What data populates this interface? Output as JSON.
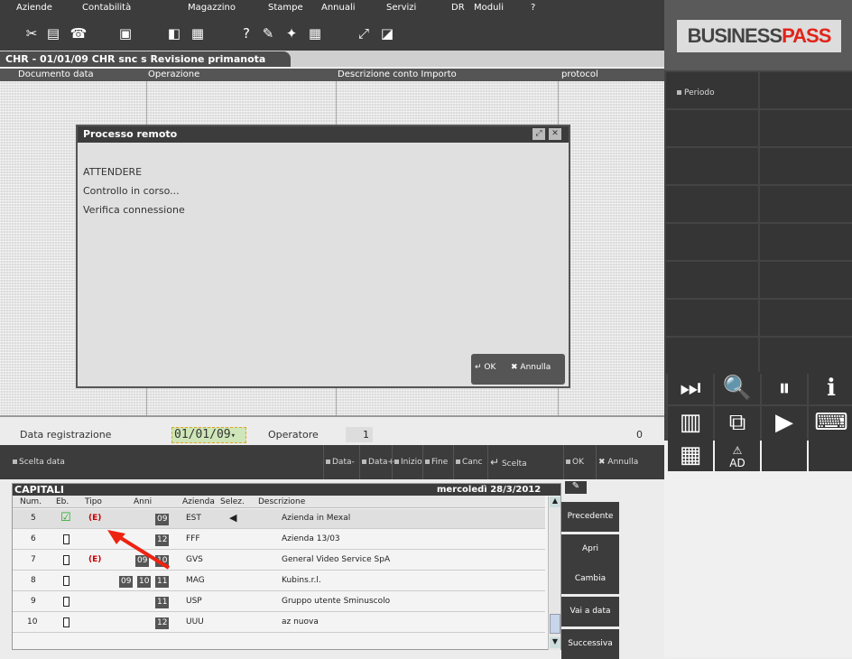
{
  "menu": [
    "Aziende",
    "Contabilità",
    "Magazzino",
    "Stampe",
    "Annuali",
    "Servizi",
    "DR",
    "Moduli",
    "?"
  ],
  "brand": {
    "part1": "BUSINESS",
    "part2": "PASS"
  },
  "tab": {
    "title": "CHR - 01/01/09  CHR snc s  Revisione primanota"
  },
  "columns": {
    "doc": "Documento  data",
    "op": "Operazione",
    "desc": "Descrizione  conto  Importo",
    "prot": "protocol"
  },
  "dialog": {
    "title": "Processo remoto",
    "line1": "ATTENDERE",
    "line2": "Controllo in corso...",
    "line3": "Verifica connessione",
    "ok": "OK",
    "cancel": "Annulla"
  },
  "form": {
    "date_label": "Data registrazione",
    "date_value": "01/01/09",
    "operator_label": "Operatore",
    "operator_value": "1",
    "count": "0"
  },
  "bottom": {
    "scelta_data": "Scelta data",
    "data_minus": "Data-",
    "data_plus": "Data+",
    "inizio": "Inizio",
    "fine": "Fine",
    "canc": "Canc",
    "scelta": "Scelta",
    "ok": "OK",
    "annulla": "Annulla"
  },
  "right_panel": {
    "periodo": "Periodo",
    "ad": "AD"
  },
  "grid": {
    "title": "CAPITALI",
    "date": "mercoledì 28/3/2012",
    "headers": {
      "num": "Num.",
      "eb": "Eb.",
      "tipo": "Tipo",
      "anni": "Anni",
      "azienda": "Azienda",
      "selez": "Selez.",
      "descr": "Descrizione"
    },
    "rows": [
      {
        "num": "5",
        "tipo": "(E)",
        "anni": [
          "09"
        ],
        "azienda": "EST",
        "descr": "Azienda in Mexal"
      },
      {
        "num": "6",
        "tipo": "",
        "anni": [
          "12"
        ],
        "azienda": "FFF",
        "descr": "Azienda 13/03"
      },
      {
        "num": "7",
        "tipo": "(E)",
        "anni": [
          "09",
          "10"
        ],
        "azienda": "GVS",
        "descr": "General Video Service SpA"
      },
      {
        "num": "8",
        "tipo": "",
        "anni": [
          "09",
          "10",
          "11"
        ],
        "azienda": "MAG",
        "descr": "Kubins.r.l."
      },
      {
        "num": "9",
        "tipo": "",
        "anni": [
          "11"
        ],
        "azienda": "USP",
        "descr": "Gruppo utente Sminuscolo"
      },
      {
        "num": "10",
        "tipo": "",
        "anni": [
          "12"
        ],
        "azienda": "UUU",
        "descr": "az nuova"
      }
    ]
  },
  "side_buttons": {
    "prev": "Precedente",
    "open": "Apri",
    "change": "Cambia",
    "goto": "Vai a data",
    "next": "Successiva"
  }
}
